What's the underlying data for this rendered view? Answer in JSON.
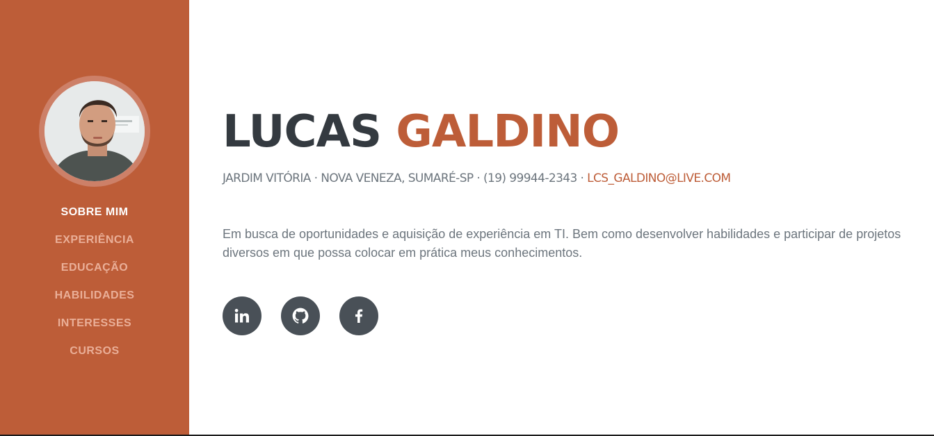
{
  "sidebar": {
    "nav": [
      {
        "label": "SOBRE MIM",
        "active": true
      },
      {
        "label": "EXPERIÊNCIA",
        "active": false
      },
      {
        "label": "EDUCAÇÃO",
        "active": false
      },
      {
        "label": "HABILIDADES",
        "active": false
      },
      {
        "label": "INTERESSES",
        "active": false
      },
      {
        "label": "CURSOS",
        "active": false
      }
    ]
  },
  "profile": {
    "first_name": "LUCAS",
    "last_name": "GALDINO",
    "address": "JARDIM VITÓRIA · NOVA VENEZA, SUMARÉ-SP · (19) 99944-2343 · ",
    "email": "LCS_GALDINO@LIVE.COM",
    "bio": "Em busca de oportunidades e aquisição de experiência em TI. Bem como desenvolver habilidades e participar de projetos diversos em que possa colocar em prática meus conhecimentos."
  },
  "social": [
    {
      "icon": "linkedin-icon"
    },
    {
      "icon": "github-icon"
    },
    {
      "icon": "facebook-icon"
    }
  ],
  "colors": {
    "accent": "#bd5d38",
    "heading": "#343a40",
    "text": "#6c757d",
    "nav_inactive": "#eaaf98",
    "social_bg": "#495057"
  }
}
